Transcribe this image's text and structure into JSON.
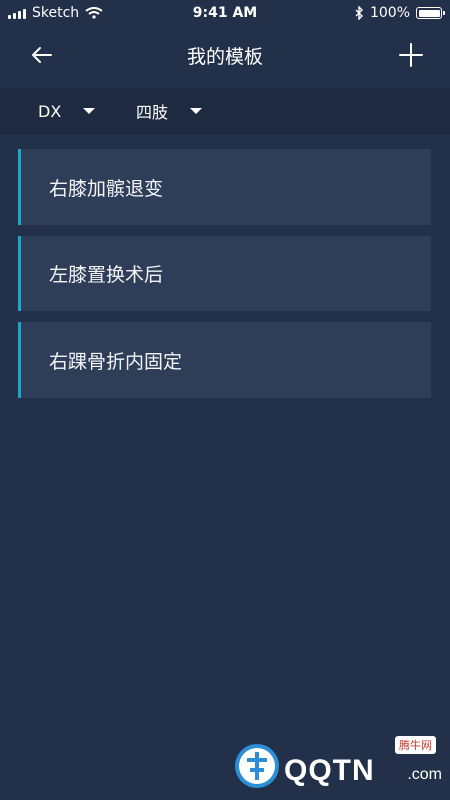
{
  "status_bar": {
    "carrier": "Sketch",
    "time": "9:41 AM",
    "battery": "100%",
    "battery_level": 1.0
  },
  "nav": {
    "title": "我的模板",
    "back_icon": "arrow-left-icon",
    "add_icon": "add-icon"
  },
  "filters": [
    {
      "label": "DX"
    },
    {
      "label": "四肢"
    }
  ],
  "templates": [
    {
      "label": "右膝加髌退变"
    },
    {
      "label": "左膝置换术后"
    },
    {
      "label": "右踝骨折内固定"
    }
  ],
  "watermark": {
    "brand": "QQTN",
    "suffix": ".com",
    "badge": "腾牛网"
  },
  "colors": {
    "background": "#22304a",
    "filter_bar": "#1e2a40",
    "card": "#2f3e58",
    "accent": "#1aa7c8"
  }
}
